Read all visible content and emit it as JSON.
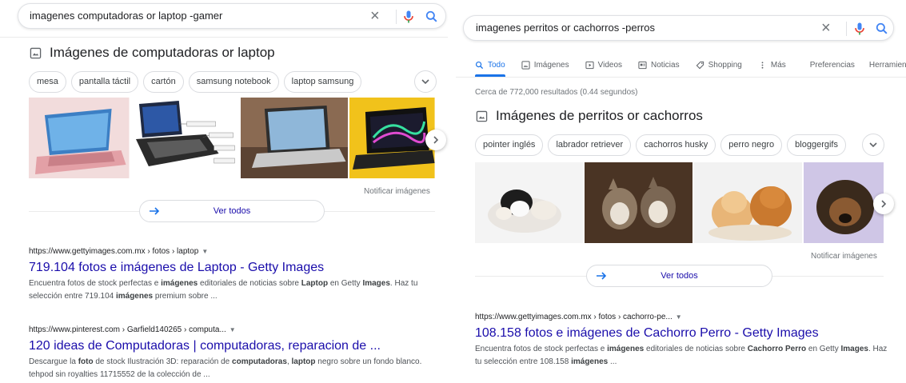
{
  "left": {
    "search": {
      "query": "imagenes computadoras or laptop -gamer",
      "clear_icon": "close-icon",
      "mic_icon": "mic-icon",
      "search_icon": "search-icon"
    },
    "images_section": {
      "icon": "image-icon",
      "title": "Imágenes de computadoras or laptop",
      "chips": [
        "mesa",
        "pantalla táctil",
        "cartón",
        "samsung notebook",
        "laptop samsung"
      ],
      "report": "Notificar imágenes",
      "view_all": "Ver todos"
    },
    "results": [
      {
        "cite": "https://www.gettyimages.com.mx › fotos › laptop",
        "title": "719.104 fotos e imágenes de Laptop - Getty Images",
        "snippet_parts": [
          {
            "t": "Encuentra fotos de stock perfectas e ",
            "b": false
          },
          {
            "t": "imágenes",
            "b": true
          },
          {
            "t": " editoriales de noticias sobre ",
            "b": false
          },
          {
            "t": "Laptop",
            "b": true
          },
          {
            "t": " en Getty ",
            "b": false
          },
          {
            "t": "Images",
            "b": true
          },
          {
            "t": ". Haz tu selección entre 719.104 ",
            "b": false
          },
          {
            "t": "imágenes",
            "b": true
          },
          {
            "t": " premium sobre ...",
            "b": false
          }
        ]
      },
      {
        "cite": "https://www.pinterest.com › Garfield140265 › computa...",
        "title": "120 ideas de Computadoras | computadoras, reparacion de ...",
        "snippet_parts": [
          {
            "t": "Descargue la ",
            "b": false
          },
          {
            "t": "foto",
            "b": true
          },
          {
            "t": " de stock Ilustración 3D: reparación de ",
            "b": false
          },
          {
            "t": "computadoras",
            "b": true
          },
          {
            "t": ", ",
            "b": false
          },
          {
            "t": "laptop",
            "b": true
          },
          {
            "t": " negro sobre un fondo blanco. tehpod sin royalties 11715552 de la colección de ...",
            "b": false
          }
        ]
      }
    ]
  },
  "right": {
    "search": {
      "query": "imagenes perritos or cachorros -perros",
      "clear_icon": "close-icon",
      "mic_icon": "mic-icon",
      "search_icon": "search-icon"
    },
    "tabs": [
      {
        "label": "Todo",
        "icon": "search-icon",
        "active": true
      },
      {
        "label": "Imágenes",
        "icon": "image-icon",
        "active": false
      },
      {
        "label": "Videos",
        "icon": "play-icon",
        "active": false
      },
      {
        "label": "Noticias",
        "icon": "news-icon",
        "active": false
      },
      {
        "label": "Shopping",
        "icon": "tag-icon",
        "active": false
      },
      {
        "label": "Más",
        "icon": "more-vert-icon",
        "active": false
      },
      {
        "label": "Preferencias",
        "icon": "",
        "active": false
      },
      {
        "label": "Herramientas",
        "icon": "",
        "active": false
      }
    ],
    "stats": "Cerca de 772,000 resultados (0.44 segundos)",
    "images_section": {
      "icon": "image-icon",
      "title": "Imágenes de perritos or cachorros",
      "chips": [
        "pointer inglés",
        "labrador retriever",
        "cachorros husky",
        "perro negro",
        "bloggergifs"
      ],
      "report": "Notificar imágenes",
      "view_all": "Ver todos"
    },
    "results": [
      {
        "cite": "https://www.gettyimages.com.mx › fotos › cachorro-pe...",
        "title": "108.158 fotos e imágenes de Cachorro Perro - Getty Images",
        "snippet_parts": [
          {
            "t": "Encuentra fotos de stock perfectas e ",
            "b": false
          },
          {
            "t": "imágenes",
            "b": true
          },
          {
            "t": " editoriales de noticias sobre ",
            "b": false
          },
          {
            "t": "Cachorro Perro",
            "b": true
          },
          {
            "t": " en Getty ",
            "b": false
          },
          {
            "t": "Images",
            "b": true
          },
          {
            "t": ". Haz tu selección entre 108.158 ",
            "b": false
          },
          {
            "t": "imágenes",
            "b": true
          },
          {
            "t": " ...",
            "b": false
          }
        ]
      }
    ]
  },
  "colors": {
    "link": "#1a0dab",
    "accent": "#1a73e8",
    "text": "#202124",
    "muted": "#70757a"
  }
}
